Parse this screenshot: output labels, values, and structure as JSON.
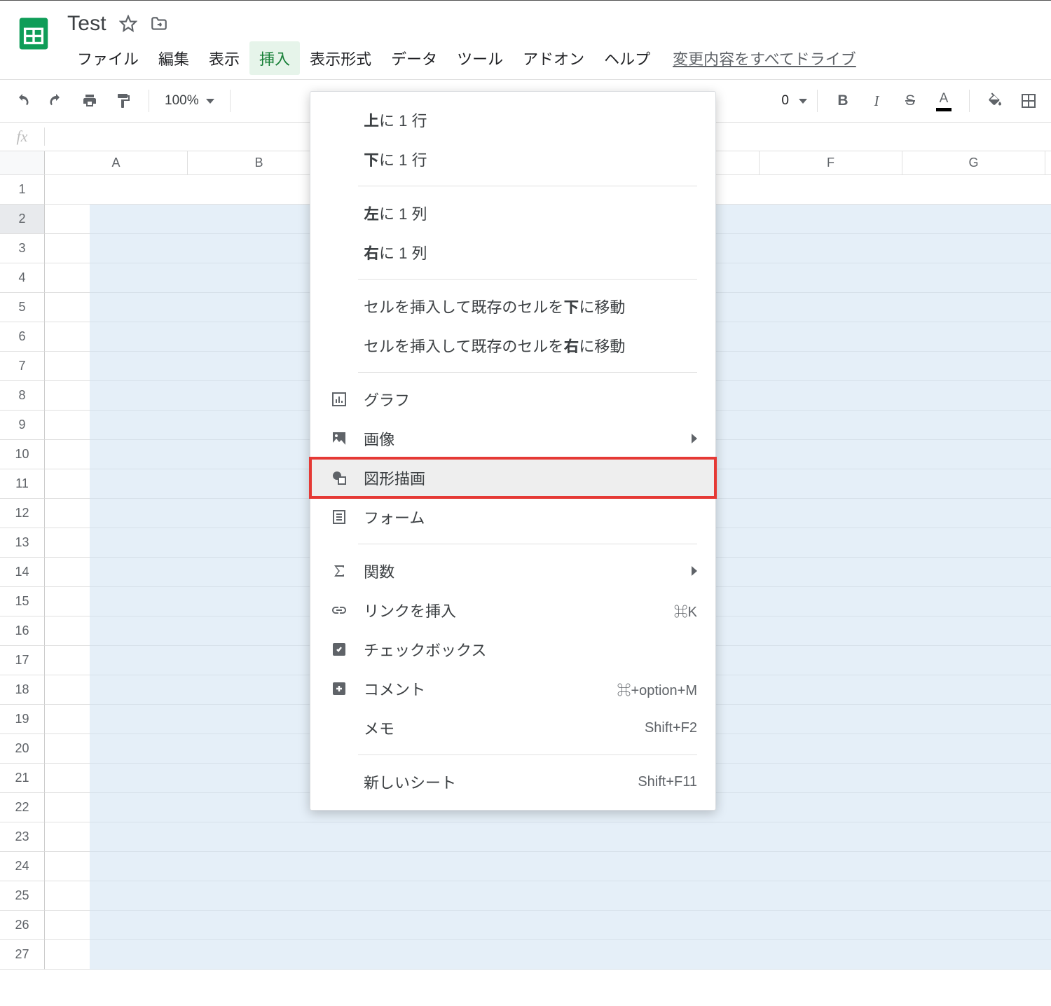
{
  "doc": {
    "title": "Test"
  },
  "menubar": {
    "items": [
      "ファイル",
      "編集",
      "表示",
      "挿入",
      "表示形式",
      "データ",
      "ツール",
      "アドオン",
      "ヘルプ"
    ],
    "active_index": 3,
    "changes_link": "変更内容をすべてドライブ"
  },
  "toolbar": {
    "zoom": "100%",
    "fontsize": "0",
    "bold": "B",
    "italic": "I",
    "strike": "S",
    "textcolor_letter": "A"
  },
  "columns": [
    "A",
    "B",
    "",
    "",
    "",
    "F",
    "G"
  ],
  "rows": [
    "1",
    "2",
    "3",
    "4",
    "5",
    "6",
    "7",
    "8",
    "9",
    "10",
    "11",
    "12",
    "13",
    "14",
    "15",
    "16",
    "17",
    "18",
    "19",
    "20",
    "21",
    "22",
    "23",
    "24",
    "25",
    "26",
    "27"
  ],
  "selected_row_header": "2",
  "dropdown": {
    "groups": [
      [
        {
          "label_pre": "",
          "label_bold": "上",
          "label_post": "に 1 行"
        },
        {
          "label_pre": "",
          "label_bold": "下",
          "label_post": "に 1 行"
        }
      ],
      [
        {
          "label_pre": "",
          "label_bold": "左",
          "label_post": "に 1 列"
        },
        {
          "label_pre": "",
          "label_bold": "右",
          "label_post": "に 1 列"
        }
      ],
      [
        {
          "label_pre": "セルを挿入して既存のセルを",
          "label_bold": "下",
          "label_post": "に移動"
        },
        {
          "label_pre": "セルを挿入して既存のセルを",
          "label_bold": "右",
          "label_post": "に移動"
        }
      ],
      [
        {
          "icon": "chart",
          "label": "グラフ"
        },
        {
          "icon": "image",
          "label": "画像",
          "submenu": true
        },
        {
          "icon": "shapes",
          "label": "図形描画",
          "highlight": true
        },
        {
          "icon": "form",
          "label": "フォーム"
        }
      ],
      [
        {
          "icon": "sigma",
          "label": "関数",
          "submenu": true
        },
        {
          "icon": "link",
          "label": "リンクを挿入",
          "shortcut": "⌘K"
        },
        {
          "icon": "checkbox",
          "label": "チェックボックス"
        },
        {
          "icon": "comment",
          "label": "コメント",
          "shortcut": "⌘+option+M"
        },
        {
          "label": "メモ",
          "shortcut": "Shift+F2"
        }
      ],
      [
        {
          "label": "新しいシート",
          "shortcut": "Shift+F11"
        }
      ]
    ]
  }
}
